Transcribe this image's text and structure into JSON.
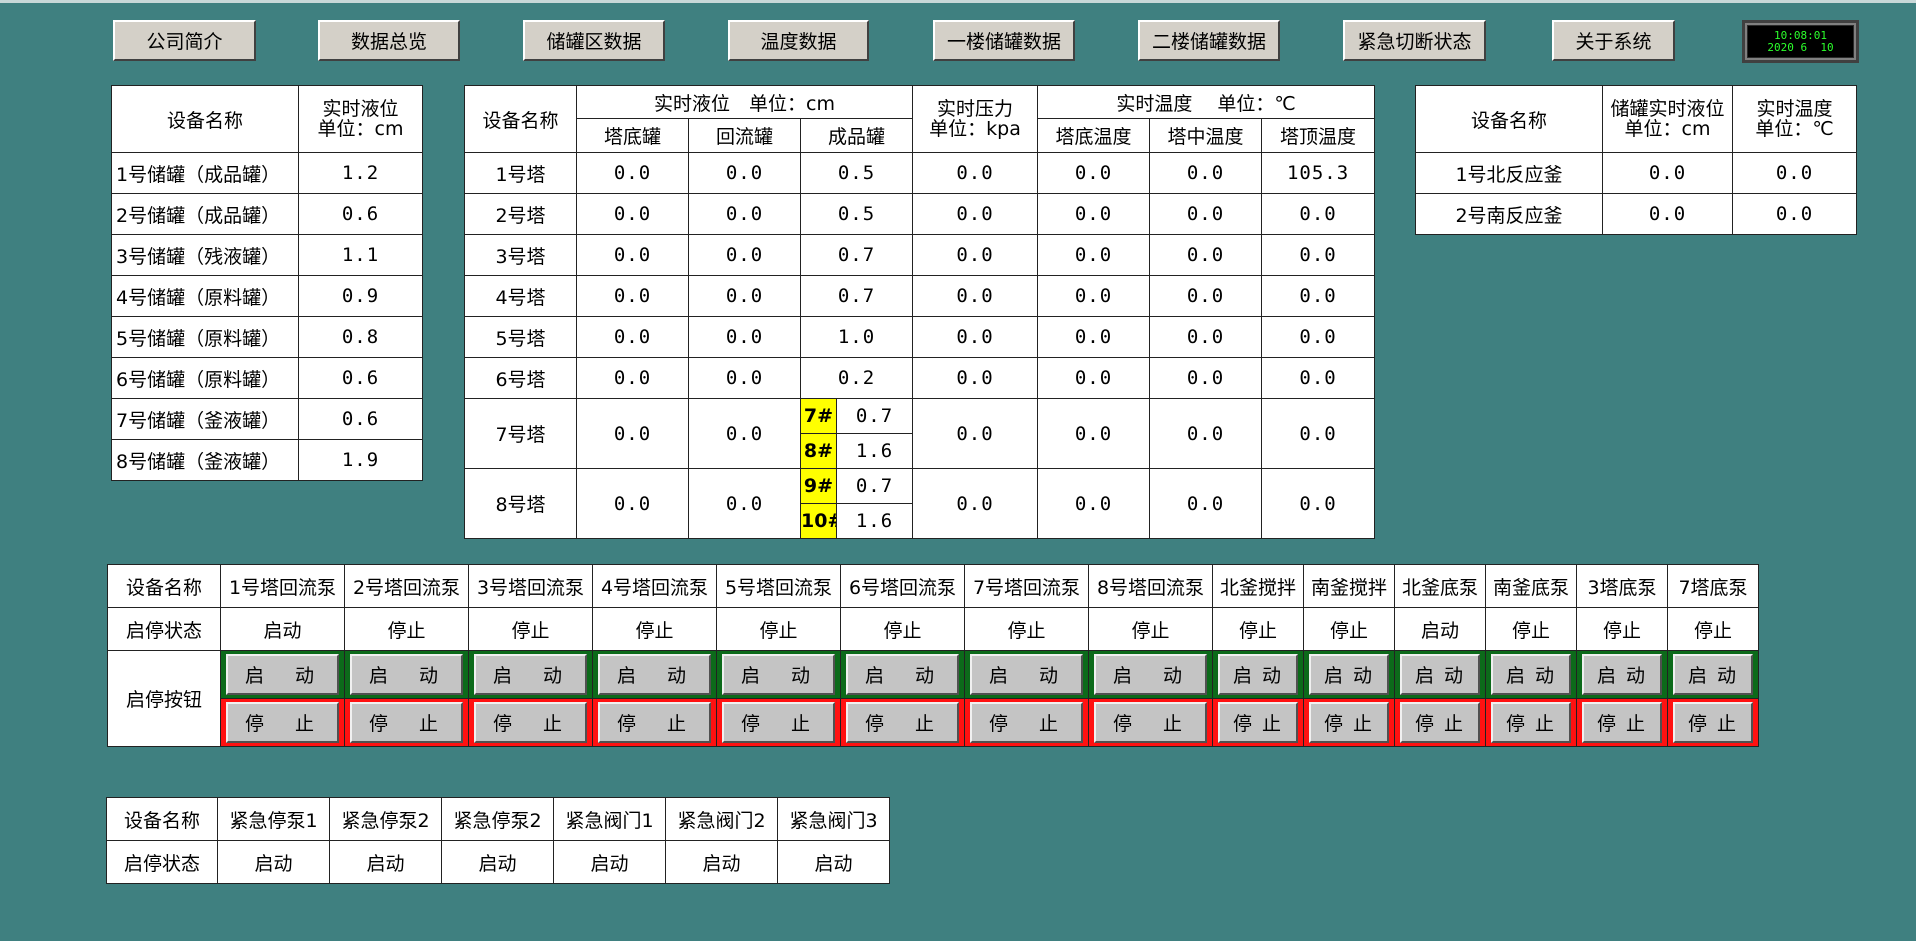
{
  "nav": [
    {
      "label": "公司简介"
    },
    {
      "label": "数据总览"
    },
    {
      "label": "储罐区数据"
    },
    {
      "label": "温度数据"
    },
    {
      "label": "一楼储罐数据"
    },
    {
      "label": "二楼储罐数据"
    },
    {
      "label": "紧急切断状态"
    },
    {
      "label": "关于系统"
    }
  ],
  "clock": {
    "time": "10:08:01",
    "date": "2020 6  10"
  },
  "tank_table": {
    "header_name": "设备名称",
    "header_level": "实时液位",
    "header_unit": "单位：cm",
    "rows": [
      {
        "name": "1号储罐（成品罐）",
        "value": "1.2"
      },
      {
        "name": "2号储罐（成品罐）",
        "value": "0.6"
      },
      {
        "name": "3号储罐（残液罐）",
        "value": "1.1"
      },
      {
        "name": "4号储罐（原料罐）",
        "value": "0.9"
      },
      {
        "name": "5号储罐（原料罐）",
        "value": "0.8"
      },
      {
        "name": "6号储罐（原料罐）",
        "value": "0.6"
      },
      {
        "name": "7号储罐（釜液罐）",
        "value": "0.6"
      },
      {
        "name": "8号储罐（釜液罐）",
        "value": "1.9"
      }
    ]
  },
  "tower_table": {
    "header_name": "设备名称",
    "level_group": "实时液位　单位：cm",
    "pressure_1": "实时压力",
    "pressure_2": "单位：kpa",
    "temp_group": "实时温度　 单位：℃",
    "sub": [
      "塔底罐",
      "回流罐",
      "成品罐",
      "塔底温度",
      "塔中温度",
      "塔顶温度"
    ],
    "rows": [
      {
        "name": "1号塔",
        "bottom": "0.0",
        "reflux": "0.0",
        "product": "0.5",
        "pressure": "0.0",
        "t_bottom": "0.0",
        "t_mid": "0.0",
        "t_top": "105.3"
      },
      {
        "name": "2号塔",
        "bottom": "0.0",
        "reflux": "0.0",
        "product": "0.5",
        "pressure": "0.0",
        "t_bottom": "0.0",
        "t_mid": "0.0",
        "t_top": "0.0"
      },
      {
        "name": "3号塔",
        "bottom": "0.0",
        "reflux": "0.0",
        "product": "0.7",
        "pressure": "0.0",
        "t_bottom": "0.0",
        "t_mid": "0.0",
        "t_top": "0.0"
      },
      {
        "name": "4号塔",
        "bottom": "0.0",
        "reflux": "0.0",
        "product": "0.7",
        "pressure": "0.0",
        "t_bottom": "0.0",
        "t_mid": "0.0",
        "t_top": "0.0"
      },
      {
        "name": "5号塔",
        "bottom": "0.0",
        "reflux": "0.0",
        "product": "1.0",
        "pressure": "0.0",
        "t_bottom": "0.0",
        "t_mid": "0.0",
        "t_top": "0.0"
      },
      {
        "name": "6号塔",
        "bottom": "0.0",
        "reflux": "0.0",
        "product": "0.2",
        "pressure": "0.0",
        "t_bottom": "0.0",
        "t_mid": "0.0",
        "t_top": "0.0"
      }
    ],
    "split_rows": [
      {
        "name": "7号塔",
        "bottom": "0.0",
        "reflux": "0.0",
        "tag_a": "7#",
        "val_a": "0.7",
        "tag_b": "8#",
        "val_b": "1.6",
        "pressure": "0.0",
        "t_bottom": "0.0",
        "t_mid": "0.0",
        "t_top": "0.0"
      },
      {
        "name": "8号塔",
        "bottom": "0.0",
        "reflux": "0.0",
        "tag_a": "9#",
        "val_a": "0.7",
        "tag_b": "10#",
        "val_b": "1.6",
        "pressure": "0.0",
        "t_bottom": "0.0",
        "t_mid": "0.0",
        "t_top": "0.0"
      }
    ]
  },
  "reactor_table": {
    "header_name": "设备名称",
    "header_level_1": "储罐实时液位",
    "header_level_2": "单位：cm",
    "header_temp_1": "实时温度",
    "header_temp_2": "单位：℃",
    "rows": [
      {
        "name": "1号北反应釜",
        "level": "0.0",
        "temp": "0.0"
      },
      {
        "name": "2号南反应釜",
        "level": "0.0",
        "temp": "0.0"
      }
    ]
  },
  "pump_table": {
    "row_name": "设备名称",
    "row_state": "启停状态",
    "row_button": "启停按钮",
    "start_label": "启　动",
    "stop_label": "停　止",
    "start_label_narrow": "启 动",
    "stop_label_narrow": "停 止",
    "columns": [
      {
        "name": "1号塔回流泵",
        "state": "启动"
      },
      {
        "name": "2号塔回流泵",
        "state": "停止"
      },
      {
        "name": "3号塔回流泵",
        "state": "停止"
      },
      {
        "name": "4号塔回流泵",
        "state": "停止"
      },
      {
        "name": "5号塔回流泵",
        "state": "停止"
      },
      {
        "name": "6号塔回流泵",
        "state": "停止"
      },
      {
        "name": "7号塔回流泵",
        "state": "停止"
      },
      {
        "name": "8号塔回流泵",
        "state": "停止"
      },
      {
        "name": "北釜搅拌",
        "state": "停止"
      },
      {
        "name": "南釜搅拌",
        "state": "停止"
      },
      {
        "name": "北釜底泵",
        "state": "启动"
      },
      {
        "name": "南釜底泵",
        "state": "停止"
      },
      {
        "name": "3塔底泵",
        "state": "停止"
      },
      {
        "name": "7塔底泵",
        "state": "停止"
      }
    ]
  },
  "emergency_table": {
    "row_name": "设备名称",
    "row_state": "启停状态",
    "columns": [
      {
        "name": "紧急停泵1",
        "state": "启动"
      },
      {
        "name": "紧急停泵2",
        "state": "启动"
      },
      {
        "name": "紧急停泵2",
        "state": "启动"
      },
      {
        "name": "紧急阀门1",
        "state": "启动"
      },
      {
        "name": "紧急阀门2",
        "state": "启动"
      },
      {
        "name": "紧急阀门3",
        "state": "启动"
      }
    ]
  }
}
